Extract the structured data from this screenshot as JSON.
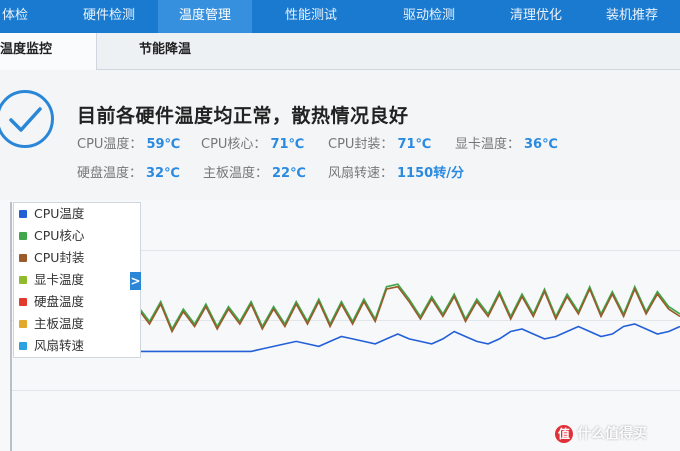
{
  "nav": {
    "tabs": [
      {
        "label": "体检"
      },
      {
        "label": "硬件检测"
      },
      {
        "label": "温度管理"
      },
      {
        "label": "性能测试"
      },
      {
        "label": "驱动检测"
      },
      {
        "label": "清理优化"
      },
      {
        "label": "装机推荐"
      }
    ],
    "active_index": 2
  },
  "subtabs": [
    {
      "label": "温度监控"
    },
    {
      "label": "节能降温"
    }
  ],
  "status": {
    "headline": "目前各硬件温度均正常，散热情况良好",
    "icon": "check-circle-icon"
  },
  "metrics": [
    {
      "label": "CPU温度：",
      "value": "59℃"
    },
    {
      "label": "CPU核心：",
      "value": "71℃"
    },
    {
      "label": "CPU封装：",
      "value": "71℃"
    },
    {
      "label": "显卡温度：",
      "value": "36℃"
    },
    {
      "label": "硬盘温度：",
      "value": "32℃"
    },
    {
      "label": "主板温度：",
      "value": "22℃"
    },
    {
      "label": "风扇转速：",
      "value": "1150转/分"
    }
  ],
  "legend": {
    "items": [
      {
        "label": "CPU温度",
        "color": "#2360d8"
      },
      {
        "label": "CPU核心",
        "color": "#3fa64a"
      },
      {
        "label": "CPU封装",
        "color": "#9a5a2a"
      },
      {
        "label": "显卡温度",
        "color": "#8fba2c"
      },
      {
        "label": "硬盘温度",
        "color": "#e23b2e"
      },
      {
        "label": "主板温度",
        "color": "#e3a92a"
      },
      {
        "label": "风扇转速",
        "color": "#2aa3e0"
      }
    ],
    "toggle_glyph": ">"
  },
  "chart_data": {
    "type": "line",
    "series": [
      {
        "name": "CPU核心",
        "color": "#3fa64a",
        "values": [
          48,
          56,
          50,
          58,
          47,
          55,
          53,
          61,
          49,
          57,
          50,
          58,
          52,
          60,
          49,
          57,
          51,
          59,
          50,
          58,
          52,
          60,
          50,
          58,
          51,
          60,
          52,
          61,
          51,
          60,
          52,
          61,
          53,
          66,
          67,
          61,
          54,
          62,
          55,
          63,
          53,
          61,
          55,
          64,
          54,
          63,
          55,
          65,
          54,
          63,
          56,
          66,
          55,
          64,
          55,
          66,
          56,
          64,
          58,
          55
        ]
      },
      {
        "name": "CPU封装",
        "color": "#9a5a2a",
        "values": [
          47,
          55,
          49,
          57,
          46,
          54,
          52,
          60,
          48,
          56,
          49,
          57,
          51,
          59,
          48,
          56,
          50,
          58,
          49,
          57,
          51,
          59,
          49,
          57,
          50,
          59,
          51,
          60,
          50,
          59,
          51,
          60,
          52,
          65,
          66,
          60,
          53,
          61,
          54,
          62,
          52,
          60,
          54,
          63,
          53,
          62,
          54,
          64,
          53,
          62,
          55,
          65,
          54,
          63,
          54,
          65,
          55,
          63,
          57,
          54
        ]
      },
      {
        "name": "CPU温度",
        "color": "#2360d8",
        "values": [
          40,
          40,
          40,
          40,
          40,
          40,
          40,
          40,
          40,
          40,
          40,
          40,
          40,
          40,
          40,
          40,
          40,
          40,
          40,
          40,
          40,
          40,
          41,
          42,
          43,
          44,
          43,
          42,
          44,
          46,
          45,
          44,
          43,
          45,
          47,
          45,
          44,
          43,
          45,
          48,
          46,
          44,
          43,
          45,
          48,
          49,
          47,
          45,
          46,
          48,
          50,
          48,
          46,
          47,
          50,
          51,
          49,
          47,
          48,
          50
        ]
      }
    ]
  },
  "watermark": {
    "text": "什么值得买",
    "badge": "值"
  }
}
